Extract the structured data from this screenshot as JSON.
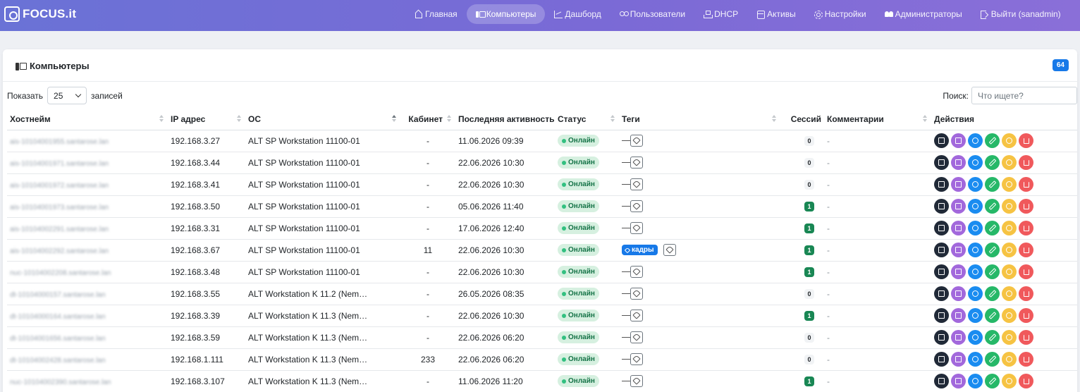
{
  "brand": {
    "name": "FOCUS.it"
  },
  "nav": [
    {
      "label": "Главная",
      "icon": "home-icon",
      "active": false
    },
    {
      "label": "Компьютеры",
      "icon": "computer-icon",
      "active": true
    },
    {
      "label": "Дашборд",
      "icon": "chart-icon",
      "active": false
    },
    {
      "label": "Пользователи",
      "icon": "users-icon",
      "active": false
    },
    {
      "label": "DHCP",
      "icon": "network-icon",
      "active": false
    },
    {
      "label": "Активы",
      "icon": "database-icon",
      "active": false
    },
    {
      "label": "Настройки",
      "icon": "gear-icon",
      "active": false
    },
    {
      "label": "Администраторы",
      "icon": "admins-icon",
      "active": false
    },
    {
      "label": "Выйти (sanadmin)",
      "icon": "logout-icon",
      "active": false
    }
  ],
  "page": {
    "title": "Компьютеры",
    "count": "64"
  },
  "length": {
    "prefix": "Показать",
    "value": "25",
    "suffix": "записей"
  },
  "search": {
    "label": "Поиск:",
    "placeholder": "Что ищете?"
  },
  "columns": [
    "Хостнейм",
    "IP адрес",
    "ОС",
    "Кабинет",
    "Последняя активность",
    "Статус",
    "Теги",
    "Сессий",
    "Комментарии",
    "Действия"
  ],
  "rows": [
    {
      "host": "ais-10104001955.santarose.lan",
      "ip": "192.168.3.27",
      "os": "ALT SP Workstation 11100-01",
      "room": "-",
      "last": "11.06.2026 09:39",
      "status": "Онлайн",
      "tags": [],
      "sessions": "0",
      "comment": "-"
    },
    {
      "host": "ais-10104001971.santarose.lan",
      "ip": "192.168.3.44",
      "os": "ALT SP Workstation 11100-01",
      "room": "-",
      "last": "22.06.2026 10:30",
      "status": "Онлайн",
      "tags": [],
      "sessions": "0",
      "comment": "-"
    },
    {
      "host": "ais-10104001972.santarose.lan",
      "ip": "192.168.3.41",
      "os": "ALT SP Workstation 11100-01",
      "room": "-",
      "last": "22.06.2026 10:30",
      "status": "Онлайн",
      "tags": [],
      "sessions": "0",
      "comment": "-"
    },
    {
      "host": "ais-10104001973.santarose.lan",
      "ip": "192.168.3.50",
      "os": "ALT SP Workstation 11100-01",
      "room": "-",
      "last": "05.06.2026 11:40",
      "status": "Онлайн",
      "tags": [],
      "sessions": "1",
      "comment": "-"
    },
    {
      "host": "ais-10104002291.santarose.lan",
      "ip": "192.168.3.31",
      "os": "ALT SP Workstation 11100-01",
      "room": "-",
      "last": "17.06.2026 12:40",
      "status": "Онлайн",
      "tags": [],
      "sessions": "1",
      "comment": "-"
    },
    {
      "host": "ais-10104002292.santarose.lan",
      "ip": "192.168.3.67",
      "os": "ALT SP Workstation 11100-01",
      "room": "11",
      "last": "22.06.2026 10:30",
      "status": "Онлайн",
      "tags": [
        "кадры"
      ],
      "sessions": "1",
      "comment": "-"
    },
    {
      "host": "nuc-10104002208.santarose.lan",
      "ip": "192.168.3.48",
      "os": "ALT SP Workstation 11100-01",
      "room": "-",
      "last": "22.06.2026 10:30",
      "status": "Онлайн",
      "tags": [],
      "sessions": "1",
      "comment": "-"
    },
    {
      "host": "dt-10104000157.santarose.lan",
      "ip": "192.168.3.55",
      "os": "ALT Workstation K 11.2 (Nem…",
      "room": "-",
      "last": "26.05.2026 08:35",
      "status": "Онлайн",
      "tags": [],
      "sessions": "0",
      "comment": "-"
    },
    {
      "host": "dt-10104000164.santarose.lan",
      "ip": "192.168.3.39",
      "os": "ALT Workstation K 11.3 (Nem…",
      "room": "-",
      "last": "22.06.2026 10:30",
      "status": "Онлайн",
      "tags": [],
      "sessions": "1",
      "comment": "-"
    },
    {
      "host": "dt-10104001656.santarose.lan",
      "ip": "192.168.3.59",
      "os": "ALT Workstation K 11.3 (Nem…",
      "room": "-",
      "last": "22.06.2026 06:20",
      "status": "Онлайн",
      "tags": [],
      "sessions": "0",
      "comment": "-"
    },
    {
      "host": "dt-10104002428.santarose.lan",
      "ip": "192.168.1.111",
      "os": "ALT Workstation K 11.3 (Nem…",
      "room": "233",
      "last": "22.06.2026 06:20",
      "status": "Онлайн",
      "tags": [],
      "sessions": "0",
      "comment": "-"
    },
    {
      "host": "nuc-10104002390.santarose.lan",
      "ip": "192.168.3.107",
      "os": "ALT Workstation K 11.3 (Nem…",
      "room": "-",
      "last": "11.06.2026 11:20",
      "status": "Онлайн",
      "tags": [],
      "sessions": "1",
      "comment": "-"
    }
  ],
  "colors": {
    "accent": "#1779e8",
    "online": "#198754",
    "navbar_start": "#6a72d6",
    "navbar_end": "#8a6fd8"
  }
}
